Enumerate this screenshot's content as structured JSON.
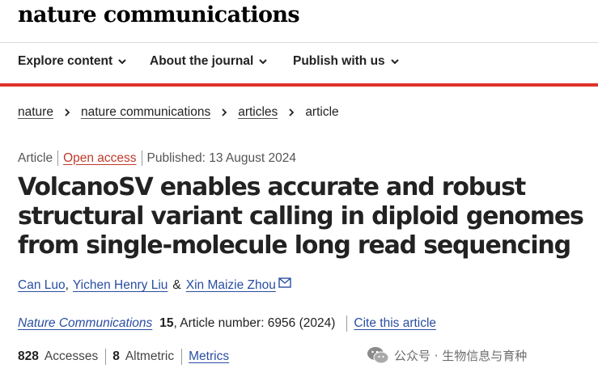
{
  "site": {
    "logo": "nature communications"
  },
  "nav": {
    "items": [
      {
        "label": "Explore content"
      },
      {
        "label": "About the journal"
      },
      {
        "label": "Publish with us"
      }
    ]
  },
  "breadcrumb": {
    "items": [
      "nature",
      "nature communications",
      "articles"
    ],
    "current": "article"
  },
  "article": {
    "type": "Article",
    "access": "Open access",
    "published": "Published: 13 August 2024",
    "title": "VolcanoSV enables accurate and robust structural variant calling in diploid genomes from single-molecule long read sequencing",
    "authors": [
      "Can Luo",
      "Yichen Henry Liu",
      "Xin Maizie Zhou"
    ],
    "author_separator": ",",
    "author_amp": "&",
    "journal": "Nature Communications",
    "volume": "15",
    "article_number": ", Article number: 6956 (2024)",
    "cite_label": "Cite this article"
  },
  "metrics": {
    "accesses_value": "828",
    "accesses_label": "Accesses",
    "altmetric_value": "8",
    "altmetric_label": "Altmetric",
    "link_label": "Metrics"
  },
  "watermark": {
    "text": "公众号 · 生物信息与育种"
  },
  "colors": {
    "accent_red": "#e0322b",
    "link_blue": "#2a4ea2",
    "open_access": "#c0392b"
  }
}
